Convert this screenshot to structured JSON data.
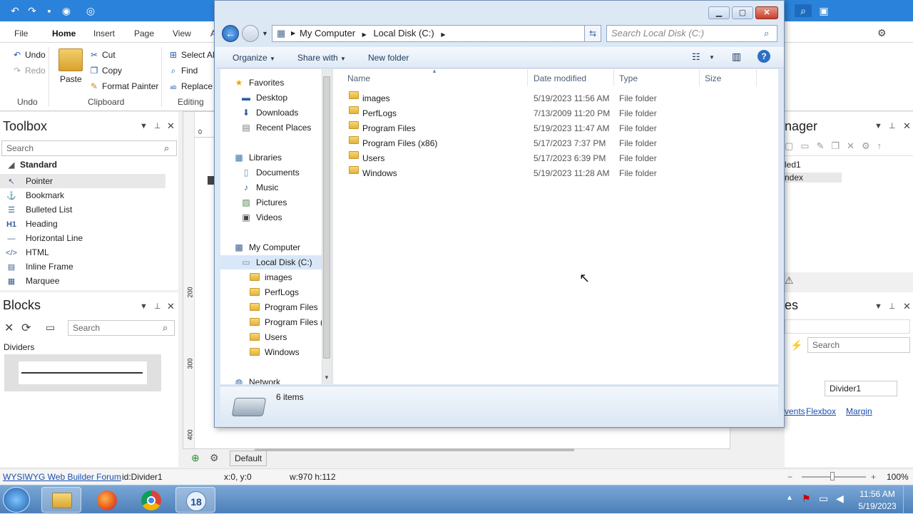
{
  "app": {
    "ribbon_tabs": [
      "File",
      "Home",
      "Insert",
      "Page",
      "View",
      "A"
    ],
    "undo": {
      "undo": "Undo",
      "redo": "Redo",
      "group": "Undo"
    },
    "clipboard": {
      "paste": "Paste",
      "cut": "Cut",
      "copy": "Copy",
      "format_painter": "Format Painter",
      "group": "Clipboard"
    },
    "editing": {
      "select_all": "Select All",
      "find": "Find",
      "replace": "Replace",
      "group": "Editing"
    }
  },
  "toolbox": {
    "title": "Toolbox",
    "search_placeholder": "Search",
    "category": "Standard",
    "items": [
      {
        "label": "Pointer",
        "icon": "pointer-icon"
      },
      {
        "label": "Bookmark",
        "icon": "bookmark-icon"
      },
      {
        "label": "Bulleted List",
        "icon": "bulleted-list-icon"
      },
      {
        "label": "Heading",
        "icon": "heading-icon"
      },
      {
        "label": "Horizontal Line",
        "icon": "horizontal-line-icon"
      },
      {
        "label": "HTML",
        "icon": "html-icon"
      },
      {
        "label": "Inline Frame",
        "icon": "inline-frame-icon"
      },
      {
        "label": "Marquee",
        "icon": "marquee-icon"
      }
    ]
  },
  "blocks": {
    "title": "Blocks",
    "search_placeholder": "Search",
    "category": "Dividers"
  },
  "right_panels": {
    "manager_title": "nager",
    "manager_items": [
      "led1",
      "ndex"
    ],
    "props_title": "es",
    "props_search_placeholder": "Search",
    "props_value": "Divider1",
    "links": [
      "vents",
      "Flexbox",
      "Margin"
    ]
  },
  "canvas": {
    "ruler_marks": [
      "0",
      "200",
      "300",
      "400"
    ],
    "page_tab": "Default"
  },
  "statusbar": {
    "forum": "WYSIWYG Web Builder Forum",
    "id": "id:Divider1",
    "pos": "x:0, y:0",
    "size": "w:970 h:112",
    "zoom": "100%"
  },
  "taskbar": {
    "time": "11:56 AM",
    "date": "5/19/2023",
    "badge": "18"
  },
  "explorer": {
    "breadcrumb": [
      "My Computer",
      "Local Disk (C:)"
    ],
    "search_placeholder": "Search Local Disk (C:)",
    "commands": {
      "organize": "Organize",
      "share": "Share with",
      "new_folder": "New folder"
    },
    "nav": {
      "favorites": "Favorites",
      "favorites_items": [
        "Desktop",
        "Downloads",
        "Recent Places"
      ],
      "libraries": "Libraries",
      "libraries_items": [
        "Documents",
        "Music",
        "Pictures",
        "Videos"
      ],
      "computer": "My Computer",
      "drive": "Local Disk (C:)",
      "drive_items": [
        "images",
        "PerfLogs",
        "Program Files",
        "Program Files (",
        "Users",
        "Windows"
      ],
      "network": "Network"
    },
    "columns": {
      "name": "Name",
      "modified": "Date modified",
      "type": "Type",
      "size": "Size"
    },
    "files": [
      {
        "name": "images",
        "modified": "5/19/2023 11:56 AM",
        "type": "File folder"
      },
      {
        "name": "PerfLogs",
        "modified": "7/13/2009 11:20 PM",
        "type": "File folder"
      },
      {
        "name": "Program Files",
        "modified": "5/19/2023 11:47 AM",
        "type": "File folder"
      },
      {
        "name": "Program Files (x86)",
        "modified": "5/17/2023 7:37 PM",
        "type": "File folder"
      },
      {
        "name": "Users",
        "modified": "5/17/2023 6:39 PM",
        "type": "File folder"
      },
      {
        "name": "Windows",
        "modified": "5/19/2023 11:28 AM",
        "type": "File folder"
      }
    ],
    "status": "6 items"
  }
}
